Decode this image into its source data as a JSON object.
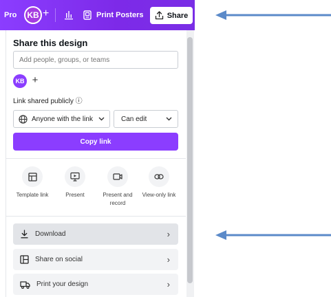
{
  "toolbar": {
    "pro_label": "Pro",
    "avatar_initials": "KB",
    "add_label": "+",
    "print_posters_label": "Print Posters",
    "share_label": "Share"
  },
  "panel": {
    "title": "Share this design",
    "people_placeholder": "Add people, groups, or teams",
    "member_initials": "KB",
    "add_member": "+",
    "public_label": "Link shared publicly ⓘ",
    "access_value": "Anyone with the link",
    "permission_value": "Can edit",
    "copy_link_label": "Copy link",
    "options": [
      {
        "label": "Template link",
        "icon": "template-icon"
      },
      {
        "label": "Present",
        "icon": "present-icon"
      },
      {
        "label": "Present and record",
        "icon": "record-icon"
      },
      {
        "label": "View-only link",
        "icon": "link-icon"
      }
    ],
    "rows": [
      {
        "label": "Download",
        "icon": "download-icon"
      },
      {
        "label": "Share on social",
        "icon": "social-icon"
      },
      {
        "label": "Print your design",
        "icon": "truck-icon"
      }
    ]
  },
  "colors": {
    "accent": "#8b3dff",
    "arrow": "#5b8ac9"
  }
}
